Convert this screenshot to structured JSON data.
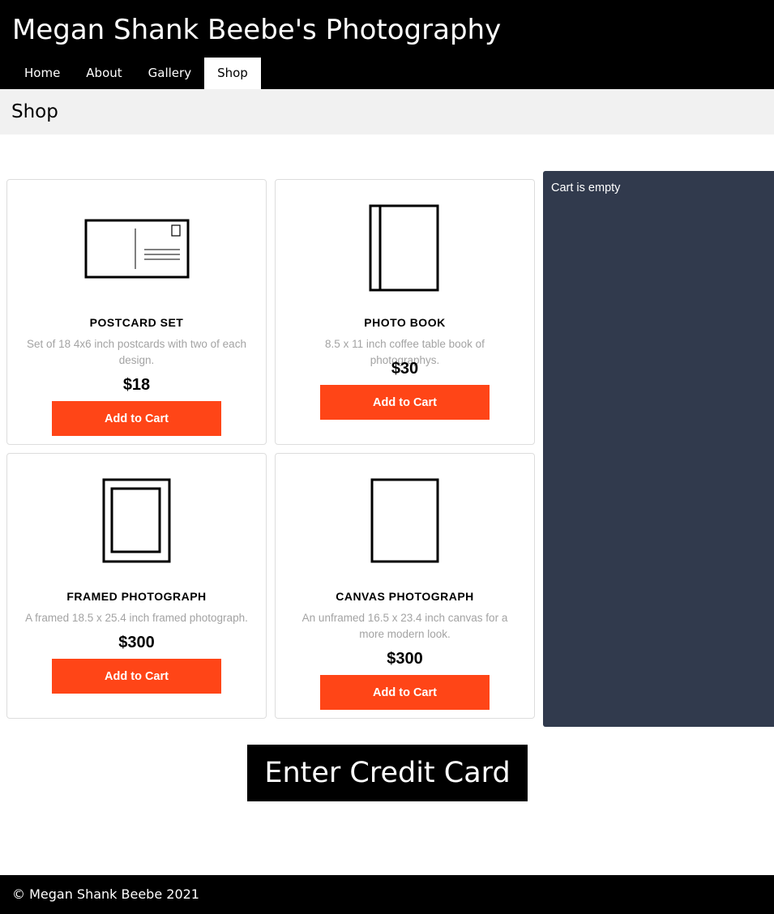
{
  "header": {
    "site_title": "Megan Shank Beebe's Photography",
    "nav": [
      {
        "label": "Home",
        "active": false
      },
      {
        "label": "About",
        "active": false
      },
      {
        "label": "Gallery",
        "active": false
      },
      {
        "label": "Shop",
        "active": true
      }
    ]
  },
  "page": {
    "heading": "Shop"
  },
  "products": [
    {
      "icon": "postcard-icon",
      "title": "POSTCARD SET",
      "description": "Set of 18 4x6 inch postcards with two of each design.",
      "price": "$18",
      "button_label": "Add to Cart"
    },
    {
      "icon": "photo-book-icon",
      "title": "PHOTO BOOK",
      "description": "8.5 x 11 inch coffee table book of photographys.",
      "price": "$30",
      "button_label": "Add to Cart"
    },
    {
      "icon": "framed-photo-icon",
      "title": "FRAMED PHOTOGRAPH",
      "description": "A framed 18.5 x 25.4 inch framed photograph.",
      "price": "$300",
      "button_label": "Add to Cart"
    },
    {
      "icon": "canvas-icon",
      "title": "CANVAS PHOTOGRAPH",
      "description": "An unframed 16.5 x 23.4 inch canvas for a more modern look.",
      "price": "$300",
      "button_label": "Add to Cart"
    }
  ],
  "cart": {
    "status": "Cart is empty"
  },
  "checkout": {
    "button_label": "Enter Credit Card"
  },
  "footer": {
    "text": "© Megan Shank Beebe 2021"
  },
  "colors": {
    "header_bg": "#000000",
    "heading_bar_bg": "#f1f1f1",
    "accent_button": "#ff4517",
    "cart_bg": "#313a4d",
    "description_text": "#a3a3a3"
  }
}
